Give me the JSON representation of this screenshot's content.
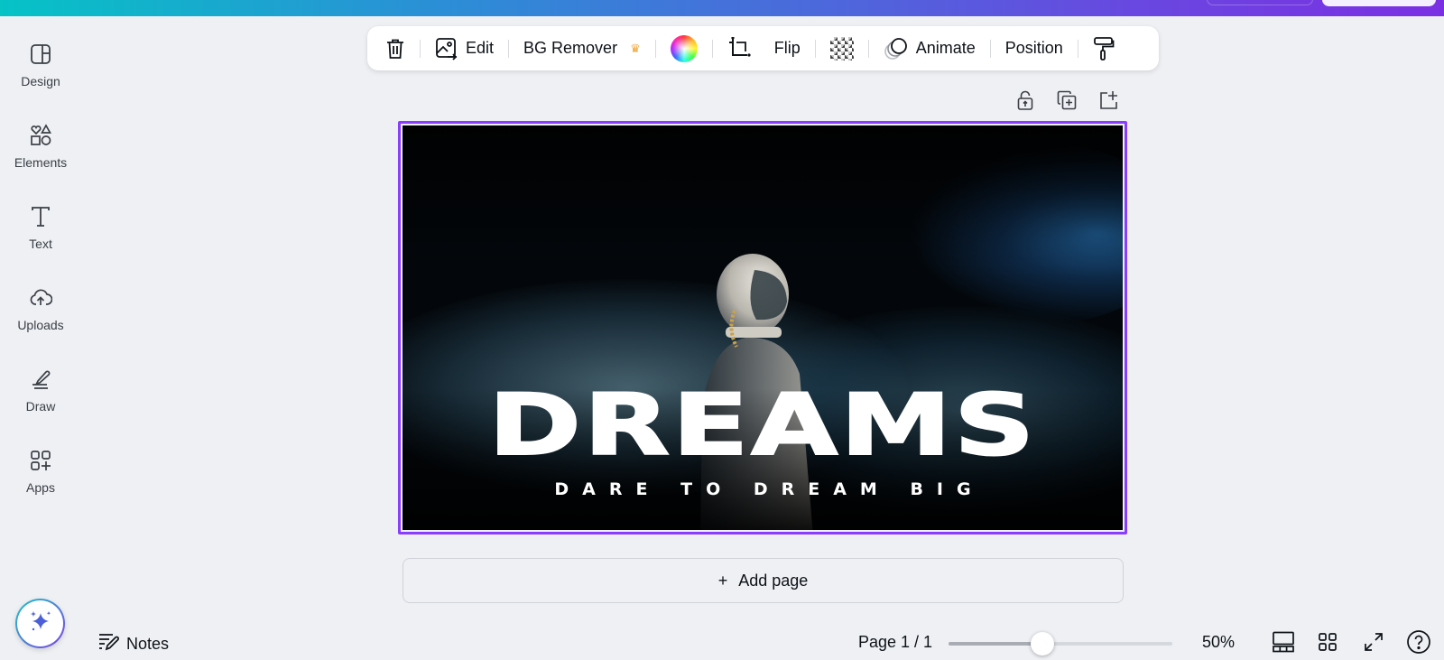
{
  "topbar": {
    "accent_start": "#06c3c6",
    "accent_end": "#7b2fe3"
  },
  "sidebar": {
    "items": [
      {
        "label": "Design",
        "icon": "design-layout-icon"
      },
      {
        "label": "Elements",
        "icon": "shapes-icon"
      },
      {
        "label": "Text",
        "icon": "text-icon"
      },
      {
        "label": "Uploads",
        "icon": "cloud-upload-icon"
      },
      {
        "label": "Draw",
        "icon": "pen-draw-icon"
      },
      {
        "label": "Apps",
        "icon": "apps-grid-icon"
      }
    ]
  },
  "toolbar": {
    "delete_icon": "trash-icon",
    "edit_label": "Edit",
    "bg_remover_label": "BG Remover",
    "bg_remover_badge": "♛",
    "color_icon": "color-wheel-icon",
    "crop_icon": "crop-icon",
    "flip_label": "Flip",
    "transparency_icon": "transparency-icon",
    "animate_label": "Animate",
    "position_label": "Position",
    "copy_style_icon": "paint-roller-icon"
  },
  "page_actions": [
    {
      "name": "lock-page",
      "icon": "unlock-icon"
    },
    {
      "name": "duplicate-page",
      "icon": "duplicate-icon"
    },
    {
      "name": "add-page",
      "icon": "add-page-icon"
    }
  ],
  "canvas": {
    "headline": "DREAMS",
    "subline": "DARE TO DREAM BIG",
    "selection_color": "#8b3dff"
  },
  "add_page_label": "Add page",
  "footer": {
    "notes_label": "Notes",
    "page_indicator": "Page 1 / 1",
    "zoom_percent": 50,
    "zoom_slider_fraction": 0.42,
    "zoom_label": "50%"
  }
}
